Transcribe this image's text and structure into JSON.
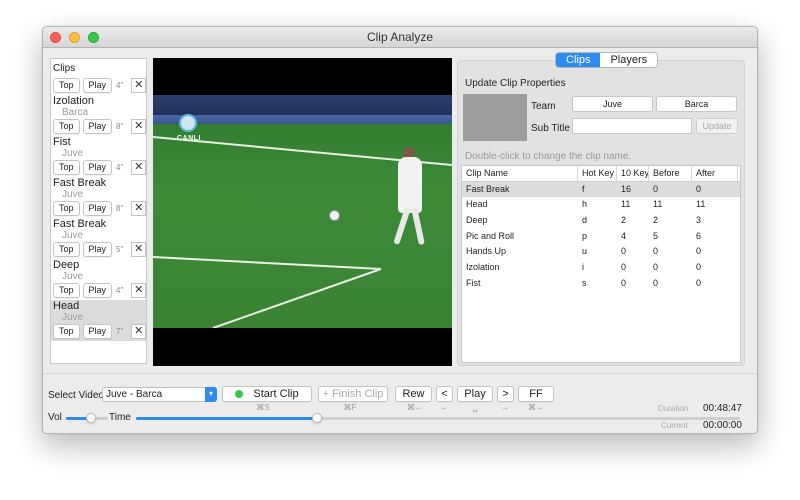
{
  "window": {
    "title": "Clip Analyze"
  },
  "sidebar": {
    "header": "Clips",
    "top_label": "Top",
    "play_label": "Play",
    "clips": [
      {
        "name": "",
        "team": "",
        "duration": "4\""
      },
      {
        "name": "Izolation",
        "team": "Barca",
        "duration": "8\""
      },
      {
        "name": "Fist",
        "team": "Juve",
        "duration": "4\""
      },
      {
        "name": "Fast Break",
        "team": "Juve",
        "duration": "8\""
      },
      {
        "name": "Fast Break",
        "team": "Juve",
        "duration": "5\""
      },
      {
        "name": "Deep",
        "team": "Juve",
        "duration": "4\""
      },
      {
        "name": "Head",
        "team": "Juve",
        "duration": "7\"",
        "selected": true
      }
    ]
  },
  "video": {
    "channel_label": "CANLI"
  },
  "tabs": {
    "clips": "Clips",
    "players": "Players",
    "active": "clips"
  },
  "update_panel": {
    "title": "Update Clip Properties",
    "team_label": "Team",
    "team_a": "Juve",
    "team_b": "Barca",
    "subtitle_label": "Sub Title",
    "subtitle_value": "",
    "update_button": "Update",
    "hint": "Double-click to change the clip name."
  },
  "clip_table": {
    "columns": [
      "Clip Name",
      "Hot Key",
      "10 Key",
      "Before",
      "After"
    ],
    "rows": [
      [
        "Fast Break",
        "f",
        "16",
        "0",
        "0"
      ],
      [
        "Head",
        "h",
        "11",
        "11",
        "11"
      ],
      [
        "Deep",
        "d",
        "2",
        "2",
        "3"
      ],
      [
        "Pic and Roll",
        "p",
        "4",
        "5",
        "6"
      ],
      [
        "Hands Up",
        "u",
        "0",
        "0",
        "0"
      ],
      [
        "Izolation",
        "i",
        "0",
        "0",
        "0"
      ],
      [
        "Fist",
        "s",
        "0",
        "0",
        "0"
      ]
    ],
    "selected_row": 0
  },
  "controls": {
    "select_video_label": "Select Video",
    "select_video_value": "Juve - Barca",
    "start_clip": "Start Clip",
    "finish_clip": "+ Finish Clip",
    "rew": "Rew",
    "prev": "<",
    "play": "Play",
    "next": ">",
    "ff": "FF",
    "shortcuts": {
      "start": "⌘S",
      "finish": "⌘F",
      "rew": "⌘←",
      "prev": "←",
      "play": "␣",
      "next": "→",
      "ff": "⌘→"
    },
    "vol_label": "Vol",
    "time_label": "Time",
    "volume_level": 0.6,
    "time_progress": 0.3,
    "duration_label": "Duration",
    "duration_value": "00:48:47",
    "current_label": "Current",
    "current_value": "00:00:00"
  }
}
